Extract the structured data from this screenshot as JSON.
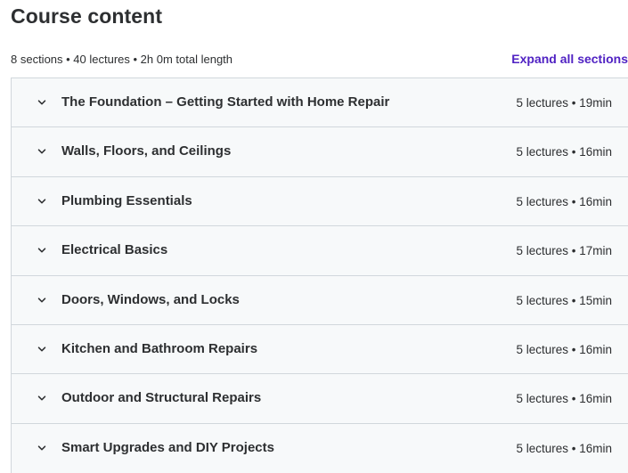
{
  "header": {
    "title": "Course content",
    "stats": "8 sections • 40 lectures • 2h 0m total length",
    "expand_all_label": "Expand all sections"
  },
  "sections": [
    {
      "title": "The Foundation – Getting Started with Home Repair",
      "meta": "5 lectures • 19min"
    },
    {
      "title": "Walls, Floors, and Ceilings",
      "meta": "5 lectures • 16min"
    },
    {
      "title": "Plumbing Essentials",
      "meta": "5 lectures • 16min"
    },
    {
      "title": "Electrical Basics",
      "meta": "5 lectures • 17min"
    },
    {
      "title": "Doors, Windows, and Locks",
      "meta": "5 lectures • 15min"
    },
    {
      "title": "Kitchen and Bathroom Repairs",
      "meta": "5 lectures • 16min"
    },
    {
      "title": "Outdoor and Structural Repairs",
      "meta": "5 lectures • 16min"
    },
    {
      "title": "Smart Upgrades and DIY Projects",
      "meta": "5 lectures • 16min"
    }
  ],
  "colors": {
    "accent": "#5022c3",
    "text": "#2d2f31",
    "panel": "#f7f9fa",
    "border": "#d1d7dc"
  }
}
